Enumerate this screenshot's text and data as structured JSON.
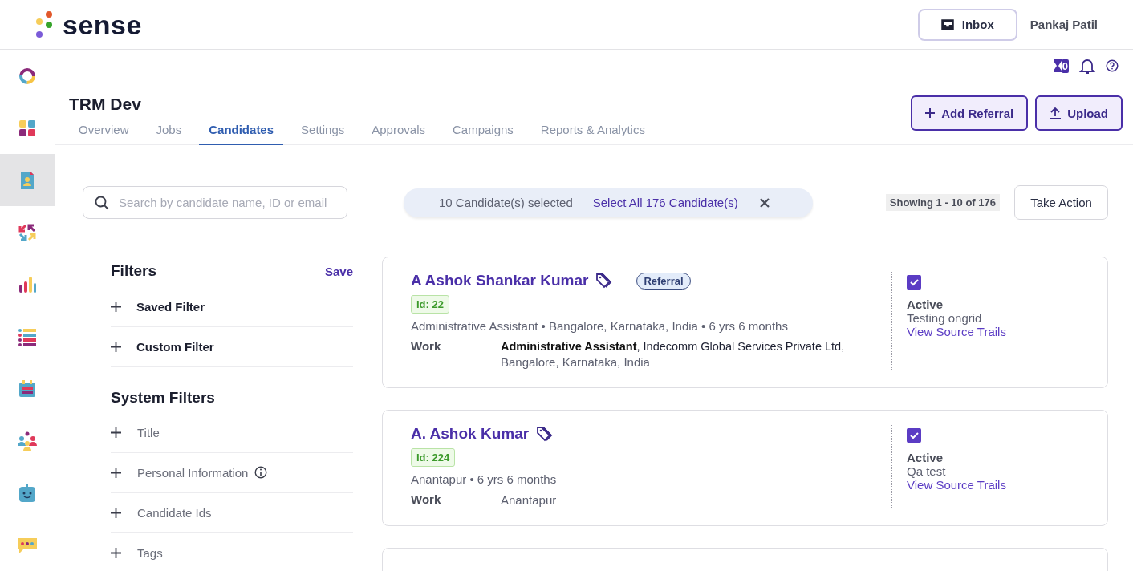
{
  "header": {
    "logo": "sense",
    "inbox_button": "Inbox",
    "user_name": "Pankaj Patil"
  },
  "rail": {
    "items": [
      {
        "kind": "ring",
        "selected": false
      },
      {
        "kind": "grid",
        "selected": false
      },
      {
        "kind": "document",
        "selected": true
      },
      {
        "kind": "arrows",
        "selected": false
      },
      {
        "kind": "chart",
        "selected": false
      },
      {
        "kind": "list",
        "selected": false
      },
      {
        "kind": "calendar",
        "selected": false
      },
      {
        "kind": "people",
        "selected": false
      },
      {
        "kind": "robot",
        "selected": false
      },
      {
        "kind": "chat",
        "selected": false
      }
    ]
  },
  "utility": {
    "timer_count": "0"
  },
  "page": {
    "title": "TRM Dev",
    "tabs": [
      {
        "label": "Overview",
        "selected": false
      },
      {
        "label": "Jobs",
        "selected": false
      },
      {
        "label": "Candidates",
        "selected": true
      },
      {
        "label": "Settings",
        "selected": false
      },
      {
        "label": "Approvals",
        "selected": false
      },
      {
        "label": "Campaigns",
        "selected": false
      },
      {
        "label": "Reports & Analytics",
        "selected": false
      }
    ],
    "actions": [
      {
        "kind": "add",
        "label": "Add Referral"
      },
      {
        "kind": "upload",
        "label": "Upload"
      }
    ]
  },
  "toolbar": {
    "search": {
      "placeholder": "Search by candidate name, ID or email"
    },
    "selection_text": "10 Candidate(s) selected",
    "select_all_link": "Select All 176 Candidate(s)",
    "showing": "Showing 1 - 10 of 176",
    "take_action": "Take Action"
  },
  "filters": {
    "title": "Filters",
    "save": "Save",
    "groups": [
      {
        "label": "Saved Filter"
      },
      {
        "label": "Custom Filter"
      }
    ],
    "system_title": "System Filters",
    "system_items": [
      {
        "label": "Title",
        "info": false
      },
      {
        "label": "Personal Information",
        "info": true
      },
      {
        "label": "Candidate Ids",
        "info": false
      },
      {
        "label": "Tags",
        "info": false
      }
    ]
  },
  "candidates": [
    {
      "name": "A Ashok Shankar Kumar",
      "badge": "Referral",
      "id": "Id: 22",
      "summary": "Administrative Assistant • Bangalore, Karnataka, India • 6 yrs 6 months",
      "work_label": "Work",
      "work_line": "**Administrative Assistant**, Indecomm Global Services Private Ltd,",
      "work_location": "Bangalore, Karnataka, India",
      "selected": true,
      "status": "Active",
      "note": "Testing ongrid",
      "link": "View Source Trails"
    },
    {
      "name": "A. Ashok Kumar",
      "id": "Id: 224",
      "summary": "Anantapur • 6 yrs 6 months",
      "work_label": "Work",
      "work_location": "Anantapur",
      "selected": true,
      "status": "Active",
      "note": "Qa test",
      "link": "View Source Trails"
    }
  ]
}
